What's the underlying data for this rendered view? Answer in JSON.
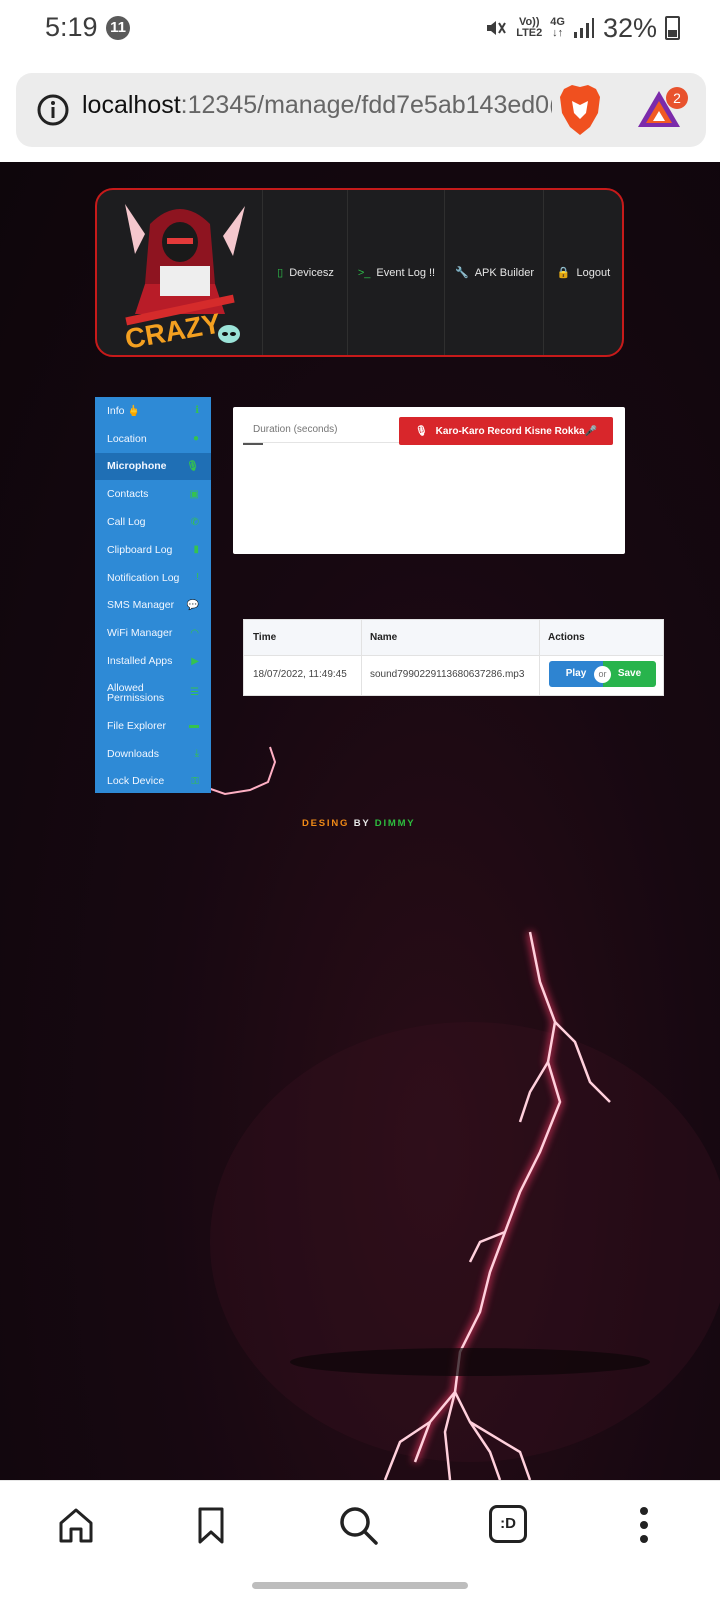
{
  "status_bar": {
    "time": "5:19",
    "notification_count": "11",
    "network_volte": "Vo))",
    "network_lte": "LTE2",
    "network_4g": "4G",
    "battery": "32%"
  },
  "browser": {
    "url_host": "localhost",
    "url_path": ":12345/manage/fdd7e5ab143ed0(",
    "bat_badge_count": "2"
  },
  "header": {
    "logo_text": "CRAZY",
    "nav": [
      {
        "label": "Devicesz",
        "icon": "mobile-icon"
      },
      {
        "label": "Event Log !!",
        "icon": "terminal-icon"
      },
      {
        "label": "APK Builder",
        "icon": "wrench-icon"
      },
      {
        "label": "Logout",
        "icon": "lock-icon"
      }
    ]
  },
  "sidebar": {
    "items": [
      {
        "label": "Info 🖕",
        "icon": "info-icon"
      },
      {
        "label": "Location",
        "icon": "map-pin-icon"
      },
      {
        "label": "Microphone",
        "icon": "microphone-icon",
        "active": true
      },
      {
        "label": "Contacts",
        "icon": "address-book-icon"
      },
      {
        "label": "Call Log",
        "icon": "phone-icon"
      },
      {
        "label": "Clipboard Log",
        "icon": "clipboard-icon"
      },
      {
        "label": "Notification Log",
        "icon": "exclamation-icon"
      },
      {
        "label": "SMS Manager",
        "icon": "chat-icon"
      },
      {
        "label": "WiFi Manager",
        "icon": "wifi-icon"
      },
      {
        "label": "Installed Apps",
        "icon": "play-icon"
      },
      {
        "label_line1": "Allowed",
        "label_line2": "Permissions",
        "icon": "list-icon"
      },
      {
        "label": "File Explorer",
        "icon": "folder-icon"
      },
      {
        "label": "Downloads",
        "icon": "download-icon"
      },
      {
        "label": "Lock Device",
        "icon": "key-icon"
      }
    ]
  },
  "microphone_panel": {
    "duration_placeholder": "Duration (seconds)",
    "record_button": "Karo-Karo Record Kisne Rokka🎤"
  },
  "recordings_table": {
    "columns": [
      "Time",
      "Name",
      "Actions"
    ],
    "rows": [
      {
        "time": "18/07/2022, 11:49:45",
        "name": "sound7990229113680637286.mp3",
        "play": "Play",
        "or": "or",
        "save": "Save"
      }
    ]
  },
  "footer_credit": {
    "part1": "DESING",
    "part2": "BY",
    "part3": "DIMMY"
  },
  "bottom_nav": {
    "tabs_label": ":D"
  },
  "colors": {
    "header_border": "#c71a1a",
    "sidebar_bg": "#2e8ad6",
    "sidebar_active": "#1f6fb5",
    "record_red": "#d8262b",
    "play_blue": "#2e84d1",
    "save_green": "#28b44c",
    "icon_green": "#35c24f"
  }
}
